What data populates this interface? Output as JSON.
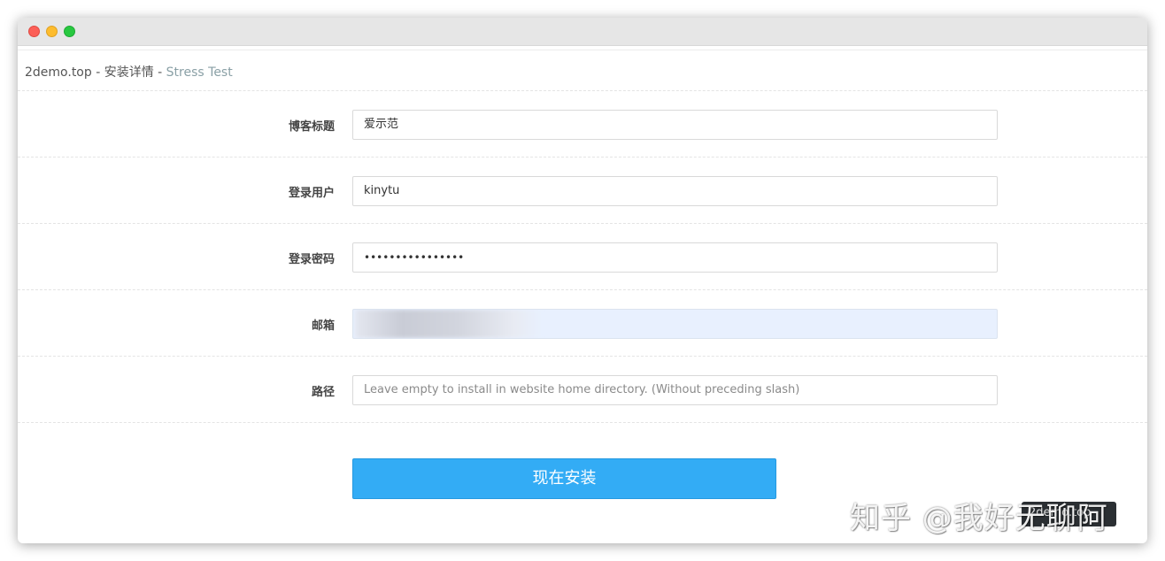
{
  "breadcrumb": {
    "site": "2demo.top",
    "sep1": " - ",
    "page": "安装详情",
    "sep2": " - ",
    "current": "Stress Test"
  },
  "form": {
    "blog_title": {
      "label": "博客标题",
      "value": "爱示范"
    },
    "login_user": {
      "label": "登录用户",
      "value": "kinytu"
    },
    "login_password": {
      "label": "登录密码",
      "value": "••••••••••••••••"
    },
    "email": {
      "label": "邮箱",
      "value": ""
    },
    "path": {
      "label": "路径",
      "placeholder": "Leave empty to install in website home directory. (Without preceding slash)"
    }
  },
  "install_button": "现在安装",
  "tooltip": "2demo.top",
  "watermark": "知乎 @我好无聊阿",
  "colors": {
    "accent": "#33acf5",
    "autofill_bg": "#e8f0fe",
    "breadcrumb_current": "#8aa0a6"
  }
}
